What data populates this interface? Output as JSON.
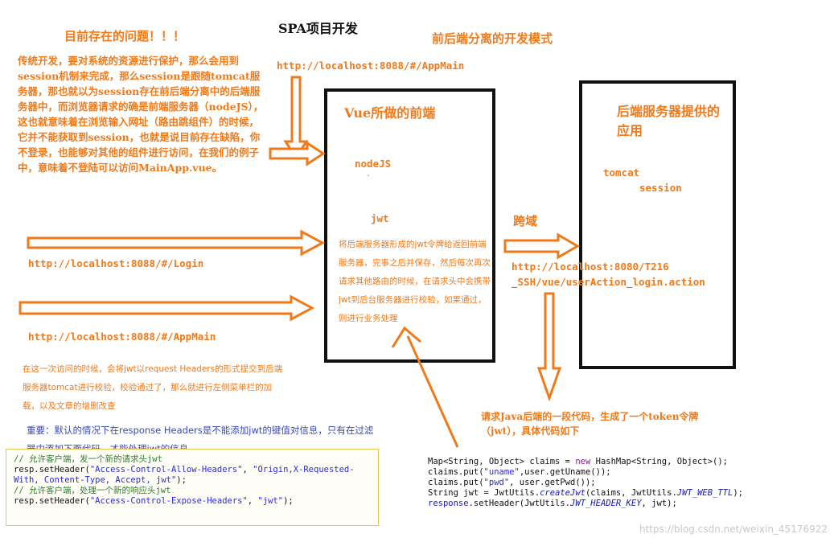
{
  "title": "SPA项目开发",
  "problem": {
    "heading": "目前存在的问题！！！",
    "body": "传统开发，要对系统的资源进行保护，那么会用到session机制来完成，那么session是跟随tomcat服务器，那也就以为session存在前后端分离中的后端服务器中，而浏览器请求的确是前端服务器（nodeJS），这也就意味着在浏览输入网址（路由跳组件）的时候，它并不能获取到session，也就是说目前存在缺陷，你不登录，也能够对其他的组件进行访问，在我们的例子中，意味着不登陆可以访问MainApp.vue。"
  },
  "mode_heading": "前后端分离的开发模式",
  "urls": {
    "top": "http://localhost:8088/#/AppMain",
    "login": "http://localhost:8088/#/Login",
    "appmain": "http://localhost:8088/#/AppMain",
    "backend_line1": "http://localhost:8080/T216",
    "backend_line2": "_SSH/vue/userAction_login.action"
  },
  "frontend": {
    "title": "Vue所做的前端",
    "node": "nodeJS",
    "dot": ".",
    "jwt": "jwt",
    "desc": "将后端服务器形成的jwt令牌给返回前端服务器，完事之后并保存，然后每次再次请求其他路由的时候，在请求头中会携带jwt到后台服务器进行校验，如果通过，则进行业务处理"
  },
  "backend": {
    "title": "后端服务器提供的应用",
    "tomcat": "tomcat",
    "session": "session"
  },
  "cross_domain": "跨域",
  "second_visit_note": "在这一次访问的时候，会将jwt以request Headers的形式提交到后端服务器tomcat进行校验，校验通过了，那么就进行左侧菜单栏的加载，以及文章的增删改查",
  "important_note": "重要：默认的情况下在response Headers是不能添加jwt的键值对信息，只有在过滤器中添加下面代码，才能处理jwt的信息",
  "java_note": "请求Java后端的一段代码，生成了一个token令牌（jwt），具体代码如下",
  "code_left": {
    "line1": "// 允许客户端，发一个新的请求头jwt",
    "line2a": "resp.setHeader(",
    "line2b": "\"Access-Control-Allow-Headers\"",
    "line2c": ", ",
    "line2d": "\"Origin,X-Requested-",
    "line3a": "With, Content-Type, Accept, jwt\"",
    "line3b": ");",
    "line4": "// 允许客户端，处理一个新的响应头jwt",
    "line5a": "resp.setHeader(",
    "line5b": "\"Access-Control-Expose-Headers\"",
    "line5c": ", ",
    "line5d": "\"jwt\"",
    "line5e": ");"
  },
  "code_right": {
    "line1a": "Map<String, Object> claims = ",
    "line1b": "new",
    "line1c": " HashMap<String, Object>();",
    "line2a": "claims.put(",
    "line2b": "\"uname\"",
    "line2c": ",user.getUname());",
    "line3a": "claims.put(",
    "line3b": "\"pwd\"",
    "line3c": ", user.getPwd());",
    "line4a": "String jwt = JwtUtils.",
    "line4b": "createJwt",
    "line4c": "(claims, JwtUtils.",
    "line4d": "JWT_WEB_TTL",
    "line4e": ");",
    "line5a": "response",
    "line5b": ".setHeader(JwtUtils.",
    "line5c": "JWT_HEADER_KEY",
    "line5d": ", jwt);"
  },
  "watermark": "https://blog.csdn.net/weixin_45176922",
  "colors": {
    "accent": "#f07a1a",
    "blue_text": "#3a49b8",
    "box_border": "#111111"
  }
}
